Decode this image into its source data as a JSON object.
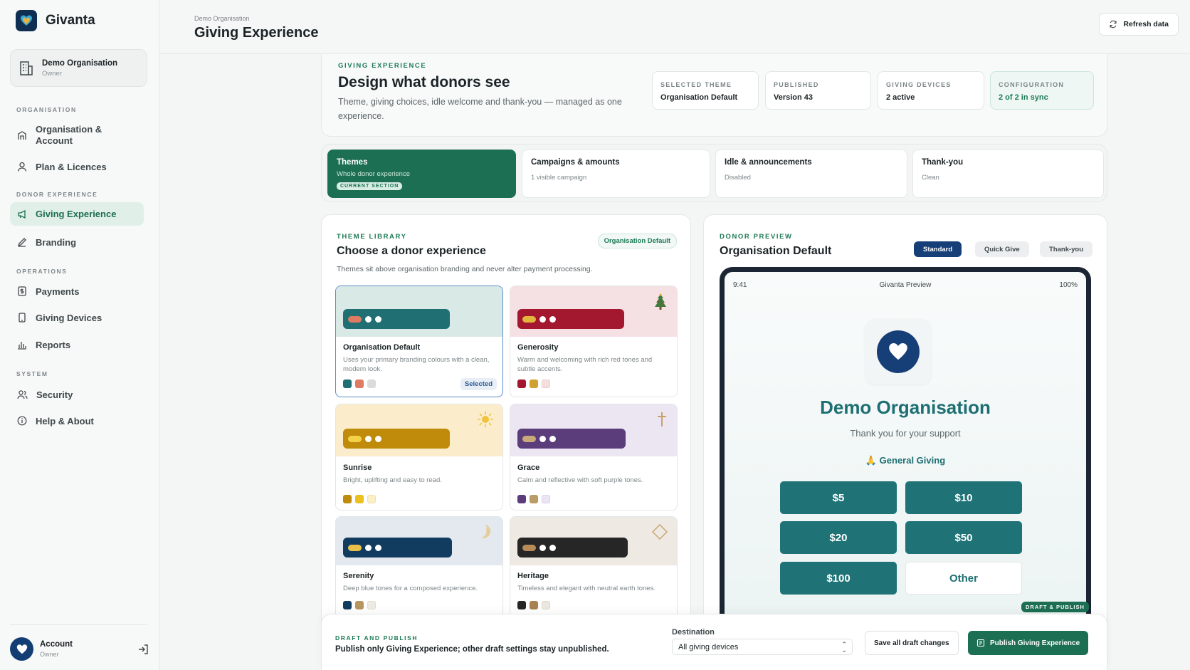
{
  "app": {
    "name": "Givanta"
  },
  "org_card": {
    "name": "Demo Organisation",
    "role": "Owner"
  },
  "sidebar": {
    "sections": [
      {
        "label": "ORGANISATION"
      },
      {
        "label": "DONOR EXPERIENCE"
      },
      {
        "label": "OPERATIONS"
      },
      {
        "label": "SYSTEM"
      }
    ],
    "items": [
      {
        "label": "Organisation &",
        "label2": "Account",
        "icon": "building-icon"
      },
      {
        "label": "Plan & Licences",
        "icon": "person-icon"
      },
      {
        "label": "Giving Experience",
        "icon": "megaphone-icon",
        "active": true
      },
      {
        "label": "Branding",
        "icon": "pen-icon"
      },
      {
        "label": "Payments",
        "icon": "dollar-icon"
      },
      {
        "label": "Giving Devices",
        "icon": "tablet-icon"
      },
      {
        "label": "Reports",
        "icon": "bar-chart-icon"
      },
      {
        "label": "Security",
        "icon": "users-icon"
      },
      {
        "label": "Help & About",
        "icon": "info-icon"
      }
    ]
  },
  "account": {
    "name": "Account",
    "role": "Owner"
  },
  "header": {
    "breadcrumb": "Demo Organisation",
    "title": "Giving Experience",
    "refresh_label": "Refresh data"
  },
  "hero": {
    "eyebrow": "GIVING EXPERIENCE",
    "title": "Design what donors see",
    "description": "Theme, giving choices, idle welcome and thank-you — managed as one experience.",
    "stats": [
      {
        "label": "SELECTED THEME",
        "value": "Organisation Default"
      },
      {
        "label": "PUBLISHED",
        "value": "Version 43"
      },
      {
        "label": "GIVING DEVICES",
        "value": "2 active"
      },
      {
        "label": "CONFIGURATION",
        "value": "2 of 2 in sync"
      }
    ]
  },
  "tabs": [
    {
      "name": "Themes",
      "sub": "Whole donor experience",
      "badge": "CURRENT SECTION"
    },
    {
      "name": "Campaigns & amounts",
      "sub": "1 visible campaign"
    },
    {
      "name": "Idle & announcements",
      "sub": "Disabled"
    },
    {
      "name": "Thank-you",
      "sub": "Clean"
    }
  ],
  "library": {
    "eyebrow": "THEME LIBRARY",
    "title": "Choose a donor experience",
    "badge": "Organisation Default",
    "description": "Themes sit above organisation branding and never alter payment processing.",
    "themes": [
      {
        "name": "Organisation Default",
        "desc": "Uses your primary branding colours with a clean, modern look.",
        "selected_label": "Selected",
        "colors": [
          "#1f6f73",
          "#e07b63",
          "#d9dcd9"
        ]
      },
      {
        "name": "Generosity",
        "desc": "Warm and welcoming with rich red tones and subtle accents.",
        "icon": "tree-icon",
        "colors": [
          "#a3182f",
          "#d1a02e",
          "#f5dede"
        ]
      },
      {
        "name": "Sunrise",
        "desc": "Bright, uplifting and easy to read.",
        "icon": "sun-icon",
        "colors": [
          "#c08a0a",
          "#ecc01f",
          "#fbefc6"
        ]
      },
      {
        "name": "Grace",
        "desc": "Calm and reflective with soft purple tones.",
        "icon": "cross-icon",
        "colors": [
          "#5b3d7c",
          "#b99c66",
          "#ece3f3"
        ]
      },
      {
        "name": "Serenity",
        "desc": "Deep blue tones for a composed experience.",
        "icon": "moon-icon",
        "colors": [
          "#123c5f",
          "#b89660",
          "#eeebe2"
        ]
      },
      {
        "name": "Heritage",
        "desc": "Timeless and elegant with neutral earth tones.",
        "icon": "diamond-icon",
        "colors": [
          "#262626",
          "#a88251",
          "#ece7e0"
        ]
      }
    ]
  },
  "preview": {
    "eyebrow": "DONOR PREVIEW",
    "title": "Organisation Default",
    "modes": [
      "Standard",
      "Quick Give",
      "Thank-you"
    ],
    "status": {
      "time": "9:41",
      "label": "Givanta Preview",
      "battery": "100%"
    },
    "org_name": "Demo Organisation",
    "thanks": "Thank you for your support",
    "fund": "🙏 General Giving",
    "amounts": [
      "$5",
      "$10",
      "$20",
      "$50",
      "$100",
      "Other"
    ],
    "draft_tag": "DRAFT & PUBLISH"
  },
  "bottom_bar": {
    "eyebrow": "DRAFT AND PUBLISH",
    "message": "Publish only Giving Experience; other draft settings stay unpublished.",
    "destination_label": "Destination",
    "destination_value": "All giving devices",
    "save_label": "Save all draft changes",
    "publish_label": "Publish Giving Experience"
  }
}
